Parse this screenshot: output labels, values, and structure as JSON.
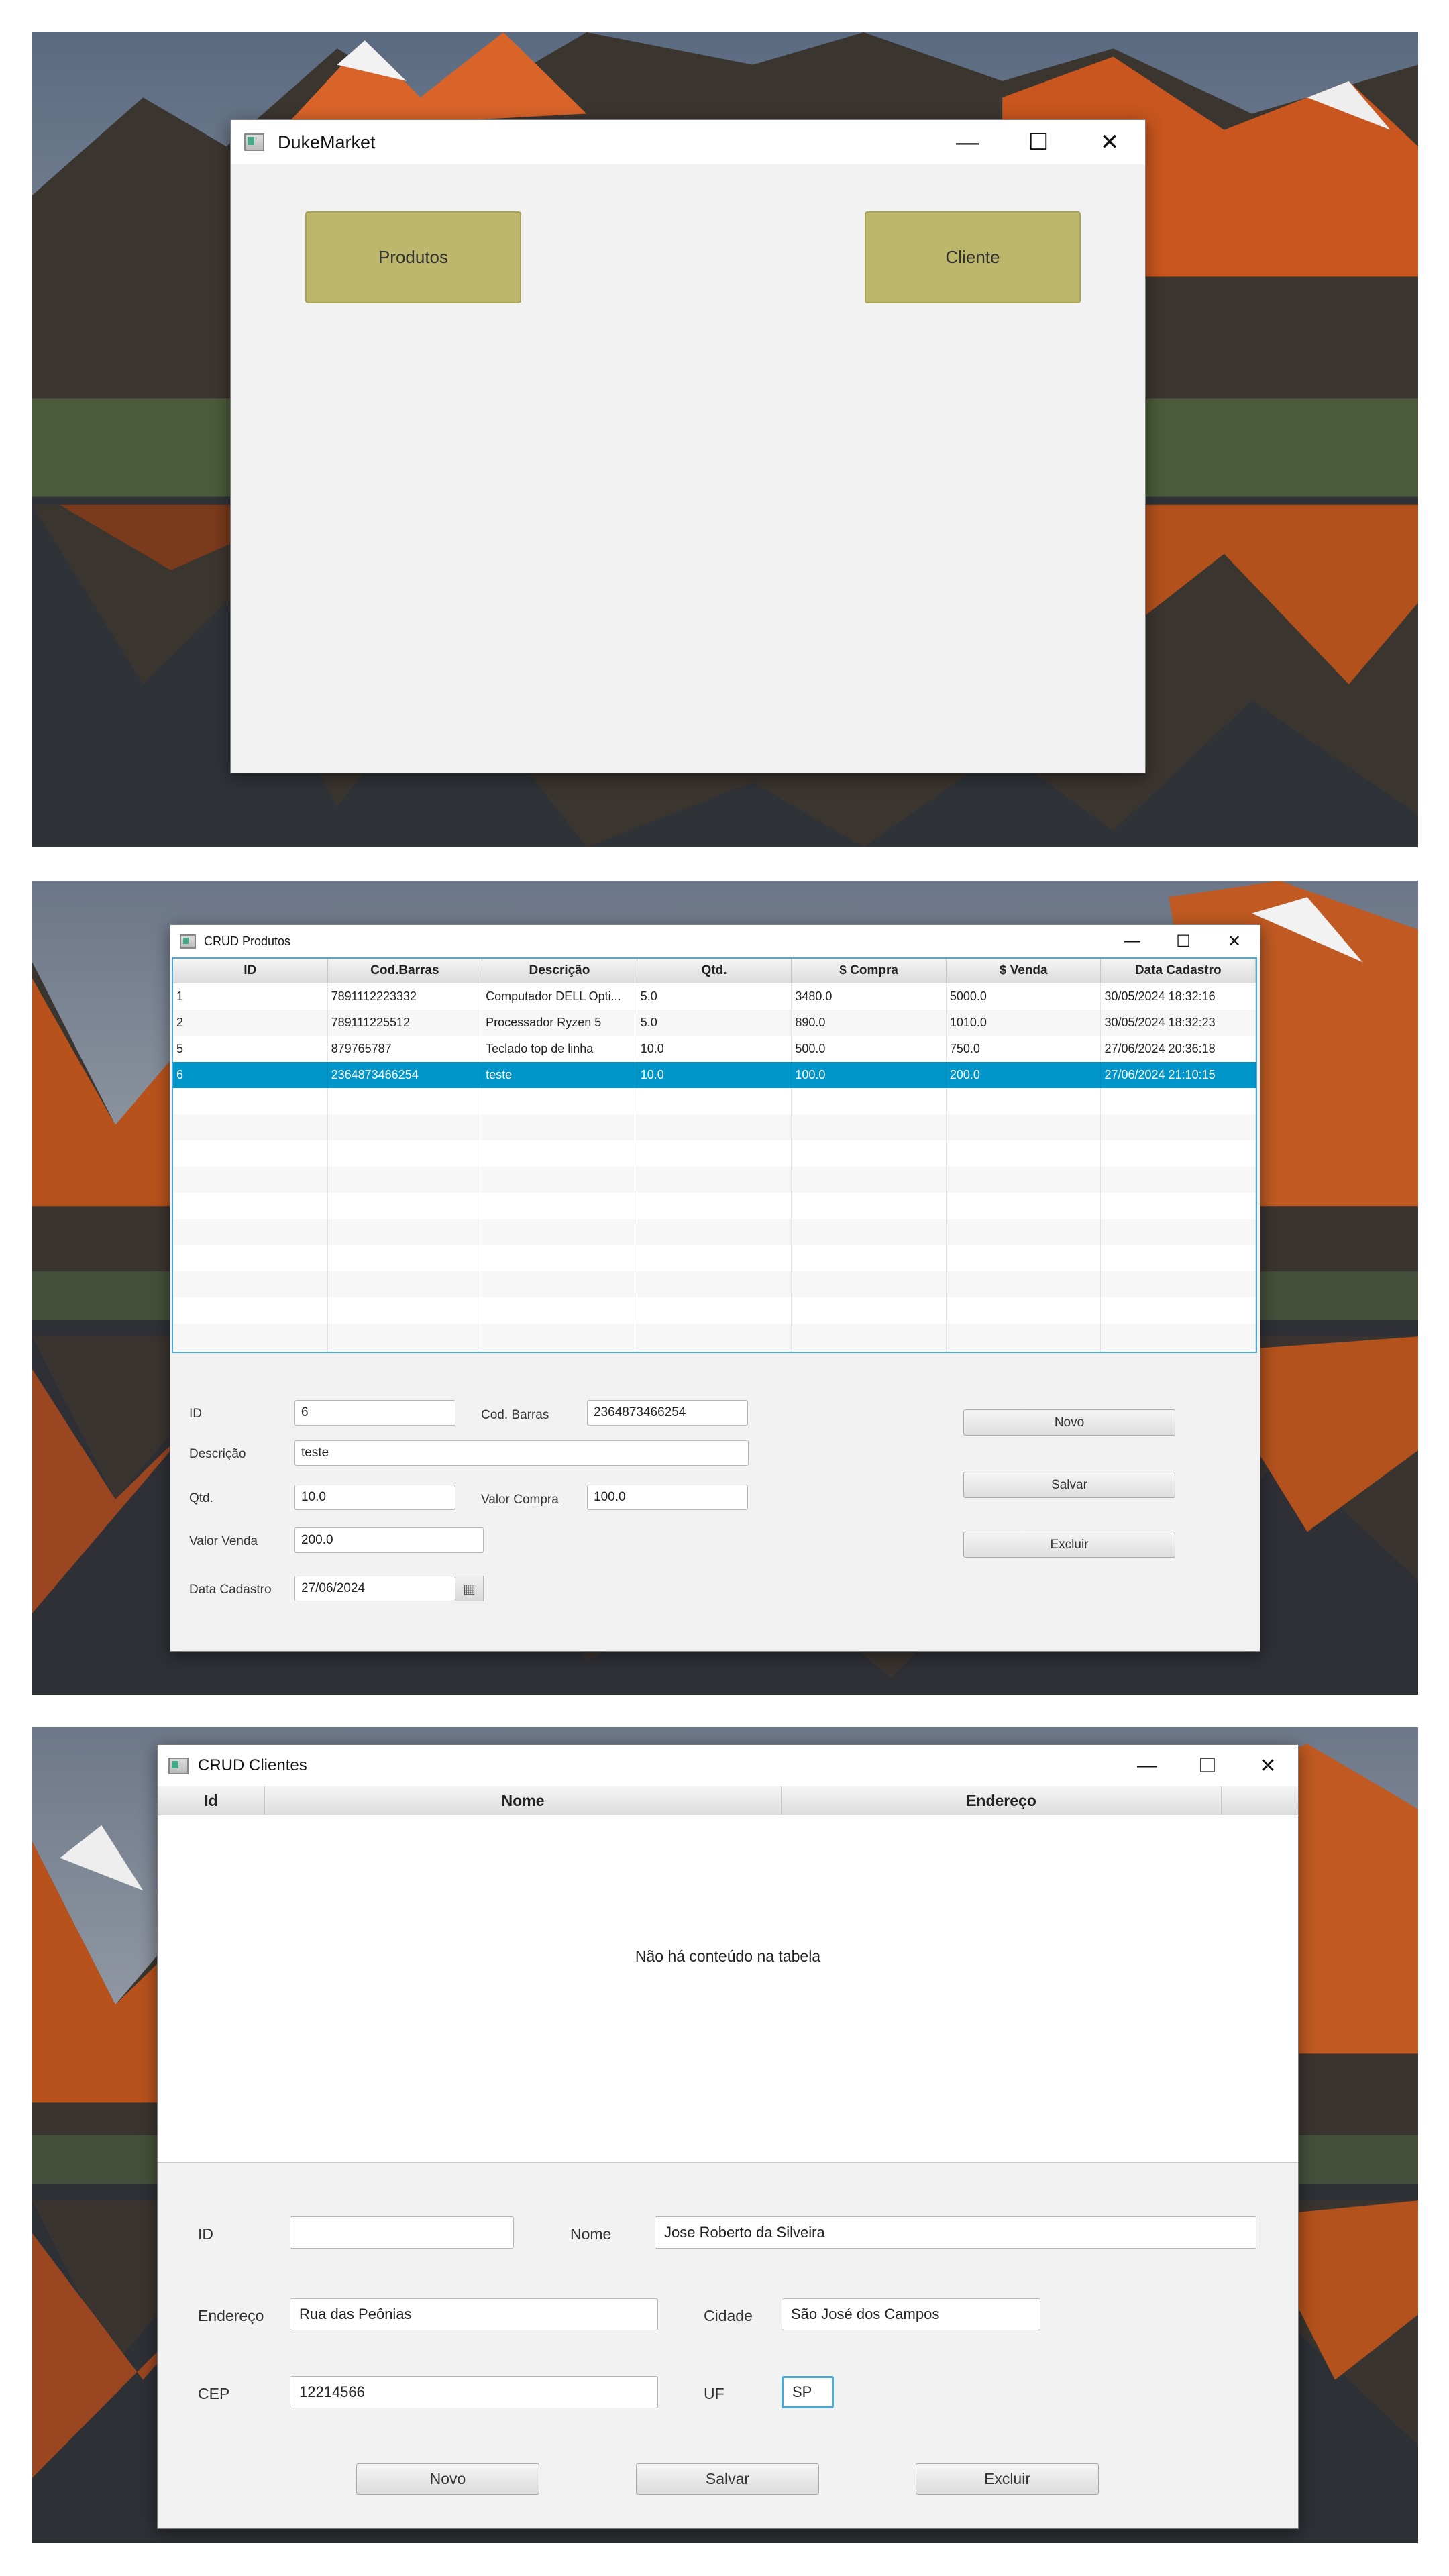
{
  "dukemarket": {
    "title": "DukeMarket",
    "buttons": {
      "produtos": "Produtos",
      "cliente": "Cliente"
    },
    "controls": {
      "minimize": "—",
      "maximize": "☐",
      "close": "✕"
    }
  },
  "crud_produtos": {
    "title": "CRUD Produtos",
    "controls": {
      "minimize": "—",
      "maximize": "☐",
      "close": "✕"
    },
    "table": {
      "columns": [
        "ID",
        "Cod.Barras",
        "Descrição",
        "Qtd.",
        "$ Compra",
        "$ Venda",
        "Data Cadastro"
      ],
      "rows": [
        [
          "1",
          "7891112223332",
          "Computador DELL Opti...",
          "5.0",
          "3480.0",
          "5000.0",
          "30/05/2024 18:32:16"
        ],
        [
          "2",
          "789111225512",
          "Processador Ryzen 5",
          "5.0",
          "890.0",
          "1010.0",
          "30/05/2024 18:32:23"
        ],
        [
          "5",
          "879765787",
          "Teclado top de linha",
          "10.0",
          "500.0",
          "750.0",
          "27/06/2024 20:36:18"
        ],
        [
          "6",
          "2364873466254",
          "teste",
          "10.0",
          "100.0",
          "200.0",
          "27/06/2024 21:10:15"
        ]
      ]
    },
    "form": {
      "id_label": "ID",
      "id_value": "6",
      "codbarras_label": "Cod. Barras",
      "codbarras_value": "2364873466254",
      "descricao_label": "Descrição",
      "descricao_value": "teste",
      "qtd_label": "Qtd.",
      "qtd_value": "10.0",
      "valor_compra_label": "Valor Compra",
      "valor_compra_value": "100.0",
      "valor_venda_label": "Valor Venda",
      "valor_venda_value": "200.0",
      "data_cadastro_label": "Data Cadastro",
      "data_cadastro_value": "27/06/2024"
    },
    "buttons": {
      "novo": "Novo",
      "salvar": "Salvar",
      "excluir": "Excluir"
    }
  },
  "crud_clientes": {
    "title": "CRUD Clientes",
    "controls": {
      "minimize": "—",
      "maximize": "☐",
      "close": "✕"
    },
    "table": {
      "columns": [
        "Id",
        "Nome",
        "Endereço"
      ],
      "empty_message": "Não há conteúdo na tabela"
    },
    "form": {
      "id_label": "ID",
      "id_value": "",
      "nome_label": "Nome",
      "nome_value": "Jose Roberto da Silveira",
      "endereco_label": "Endereço",
      "endereco_value": "Rua das Peônias",
      "cidade_label": "Cidade",
      "cidade_value": "São José dos Campos",
      "cep_label": "CEP",
      "cep_value": "12214566",
      "uf_label": "UF",
      "uf_value": "SP"
    },
    "buttons": {
      "novo": "Novo",
      "salvar": "Salvar",
      "excluir": "Excluir"
    }
  }
}
